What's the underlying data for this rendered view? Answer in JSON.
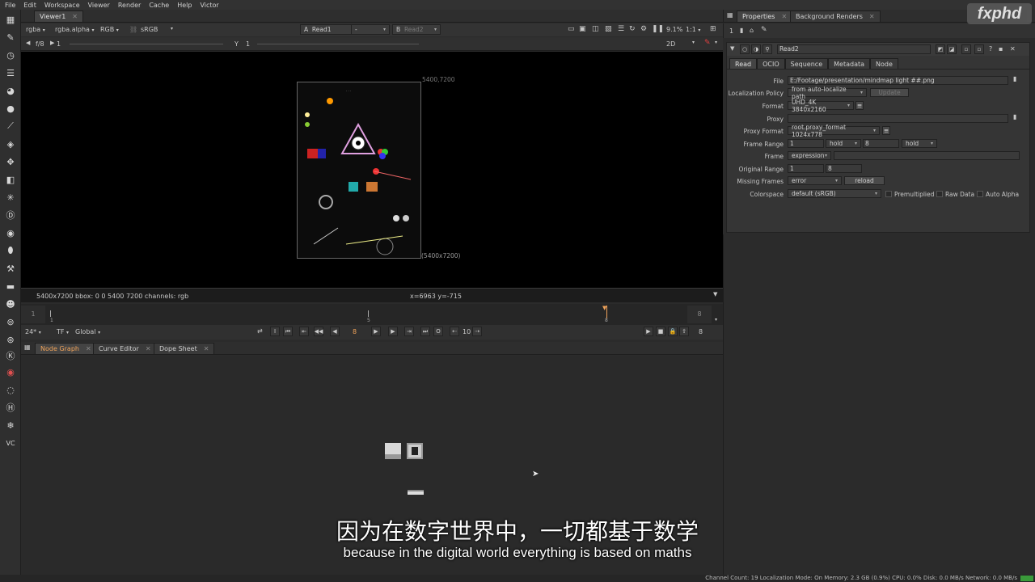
{
  "menu": [
    "File",
    "Edit",
    "Workspace",
    "Viewer",
    "Render",
    "Cache",
    "Help",
    "Victor"
  ],
  "viewer": {
    "tab": "Viewer1",
    "channels": "rgba",
    "alpha": "rgba.alpha",
    "colorspace_mode": "RGB",
    "lut": "sRGB",
    "input_a_label": "A",
    "input_a": "Read1",
    "input_op": "-",
    "input_b_label": "B",
    "input_b": "Read2",
    "zoom": "9.1%",
    "ratio": "1:1",
    "fstop": "f/8",
    "gain": "1",
    "gamma_label": "Y",
    "gamma": "1",
    "view_mode": "2D",
    "format_top": "5400,7200",
    "format_bottom": "(5400x7200)",
    "status_left": "5400x7200  bbox: 0 0 5400 7200 channels: rgb",
    "status_coords": "x=6963 y=-715"
  },
  "timeline": {
    "start": "1",
    "start_mark": "1",
    "mid_mark": "5",
    "current": "8",
    "end": "8",
    "end_right": "8",
    "fps": "24*",
    "tf": "TF",
    "scope": "Global",
    "frame_field": "8",
    "step": "10"
  },
  "panels": {
    "tabs": [
      "Node Graph",
      "Curve Editor",
      "Dope Sheet"
    ]
  },
  "properties": {
    "tab": "Properties",
    "tab2": "Background Renders",
    "count": "1",
    "node_name": "Read2",
    "subtabs": [
      "Read",
      "OCIO",
      "Sequence",
      "Metadata",
      "Node"
    ],
    "file_label": "File",
    "file": "E:/Footage/presentation/mindmap light ##.png",
    "localization_label": "Localization Policy",
    "localization": "from auto-localize path",
    "update": "Update",
    "format_label": "Format",
    "format": "UHD_4K 3840x2160",
    "proxy_label": "Proxy",
    "proxy_format_label": "Proxy Format",
    "proxy_format": "root.proxy_format 1024x778",
    "frame_range_label": "Frame Range",
    "frame_range_start": "1",
    "frame_range_before": "hold",
    "frame_range_end": "8",
    "frame_range_after": "hold",
    "frame_label": "Frame",
    "frame_mode": "expression",
    "original_range_label": "Original Range",
    "original_start": "1",
    "original_end": "8",
    "missing_frames_label": "Missing Frames",
    "missing_frames": "error",
    "reload": "reload",
    "colorspace_label": "Colorspace",
    "colorspace": "default (sRGB)",
    "premultiplied": "Premultiplied",
    "raw_data": "Raw Data",
    "auto_alpha": "Auto Alpha"
  },
  "watermark": "fxphd",
  "subtitles": {
    "cn": "因为在数字世界中，一切都基于数学",
    "en": "because in the digital world everything is based on maths"
  },
  "statusbar": "Channel Count: 19  Localization Mode: On  Memory: 2.3 GB (0.9%)  CPU: 0.0%  Disk: 0.0 MB/s  Network: 0.0 MB/s",
  "colors": {
    "accent": "#f0a35a",
    "viewer_bg": "#000000",
    "panel_bg": "#2b2b2b"
  }
}
